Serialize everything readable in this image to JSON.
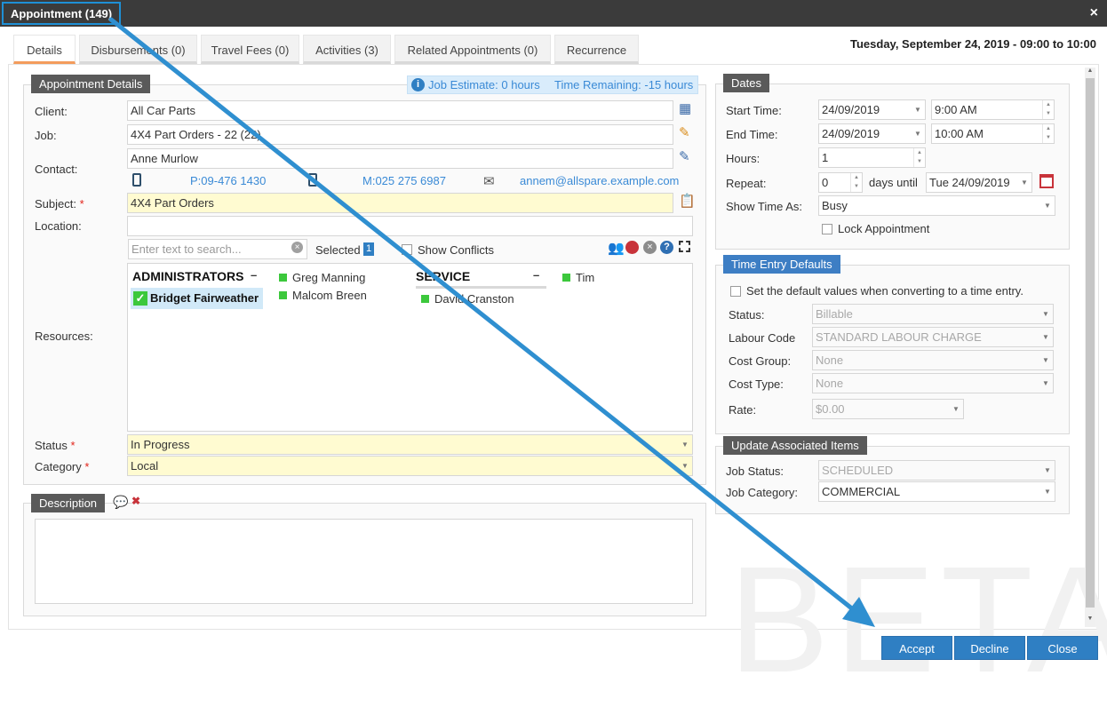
{
  "window": {
    "title": "Appointment (149)",
    "close": "×"
  },
  "tabs": [
    "Details",
    "Disbursements (0)",
    "Travel Fees (0)",
    "Activities (3)",
    "Related Appointments (0)",
    "Recurrence"
  ],
  "datetime": "Tuesday, September 24, 2019 - 09:00 to 10:00",
  "details": {
    "title": "Appointment Details",
    "estimate": "Job Estimate: 0 hours",
    "remaining": "Time Remaining: -15 hours",
    "client_label": "Client:",
    "client": "All Car Parts",
    "job_label": "Job:",
    "job": "4X4 Part Orders - 22 (22)",
    "contact_label": "Contact:",
    "contact": "Anne Murlow",
    "phone": "P:09-476 1430",
    "mobile": "M:025 275 6987",
    "email": "annem@allspare.example.com",
    "subject_label": "Subject:",
    "subject": "4X4 Part Orders",
    "location_label": "Location:",
    "location": "",
    "search_placeholder": "Enter text to search...",
    "selected_label": "Selected",
    "selected_count": "1",
    "show_conflicts": "Show Conflicts",
    "resources_label": "Resources:",
    "groups": {
      "admin": "ADMINISTRATORS",
      "service": "SERVICE",
      "dash": "–"
    },
    "selected_resource": "Bridget Fairweather",
    "resources": {
      "greg": "Greg Manning",
      "malcom": "Malcom Breen",
      "david": "David Cranston",
      "tim": "Tim"
    },
    "status_label": "Status",
    "status": "In Progress",
    "category_label": "Category",
    "category": "Local",
    "required": "*"
  },
  "description": {
    "title": "Description",
    "text": ""
  },
  "dates": {
    "title": "Dates",
    "start_label": "Start Time:",
    "start_date": "24/09/2019",
    "start_time": "9:00 AM",
    "end_label": "End Time:",
    "end_date": "24/09/2019",
    "end_time": "10:00 AM",
    "hours_label": "Hours:",
    "hours": "1",
    "repeat_label": "Repeat:",
    "repeat": "0",
    "days_until": "days until",
    "until_date": "Tue 24/09/2019",
    "show_as_label": "Show Time As:",
    "show_as": "Busy",
    "lock": "Lock Appointment"
  },
  "time_entry": {
    "title": "Time Entry Defaults",
    "set_defaults": "Set the default values when converting to a time entry.",
    "status_label": "Status:",
    "status": "Billable",
    "labour_label": "Labour Code",
    "labour": "STANDARD LABOUR CHARGE",
    "cost_group_label": "Cost Group:",
    "cost_group": "None",
    "cost_type_label": "Cost Type:",
    "cost_type": "None",
    "rate_label": "Rate:",
    "rate": "$0.00"
  },
  "associated": {
    "title": "Update Associated Items",
    "job_status_label": "Job Status:",
    "job_status": "SCHEDULED",
    "job_category_label": "Job Category:",
    "job_category": "COMMERCIAL"
  },
  "watermark": "BETA",
  "buttons": {
    "accept": "Accept",
    "decline": "Decline",
    "close": "Close"
  },
  "colors": {
    "accent": "#2f7fc3",
    "annotation": "#1e90d6",
    "required_bg": "#fffbd1",
    "active_tab": "#f39c5c"
  }
}
